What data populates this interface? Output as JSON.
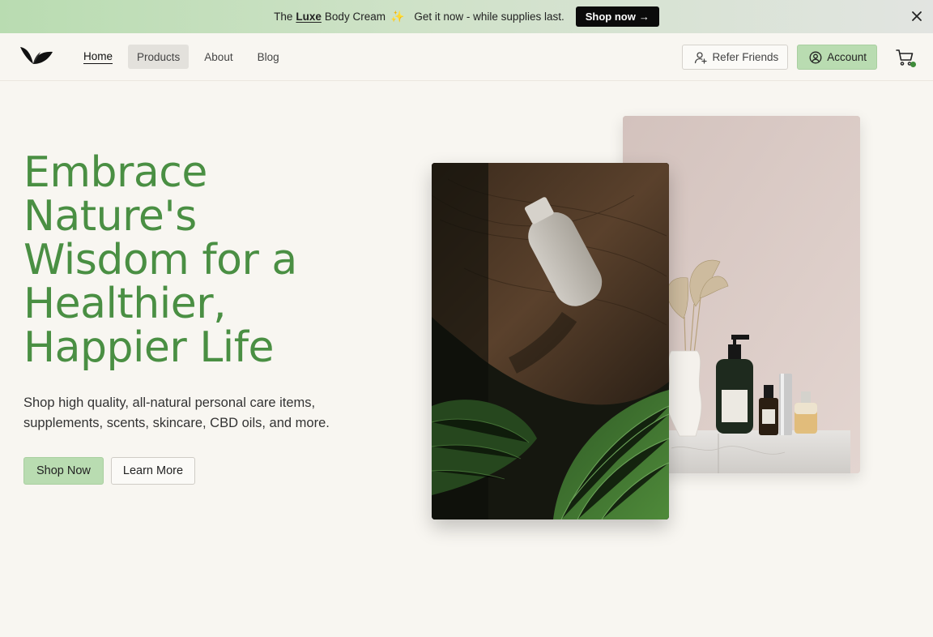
{
  "announcement": {
    "prefix": "The",
    "product": "Luxe",
    "suffix": "Body Cream",
    "sparkle": "✨",
    "message": "Get it now - while supplies last.",
    "cta": "Shop now",
    "cta_arrow": "→"
  },
  "nav": {
    "links": [
      "Home",
      "Products",
      "About",
      "Blog"
    ],
    "active": "Home",
    "refer_label": "Refer Friends",
    "account_label": "Account"
  },
  "hero": {
    "title": "Embrace Nature's Wisdom for a Healthier, Happier Life",
    "subtitle": "Shop high quality, all-natural personal care items, supplements, scents, skincare, CBD oils, and more.",
    "primary_cta": "Shop Now",
    "secondary_cta": "Learn More"
  },
  "icons": {
    "close": "close-icon",
    "refer": "user-plus-icon",
    "account": "user-circle-icon",
    "cart": "cart-icon",
    "logo": "leaf-logo"
  },
  "colors": {
    "accent_green": "#b9dcb1",
    "title_green": "#4a8f43",
    "background": "#f8f6f1",
    "cart_badge": "#3f8c3a"
  }
}
